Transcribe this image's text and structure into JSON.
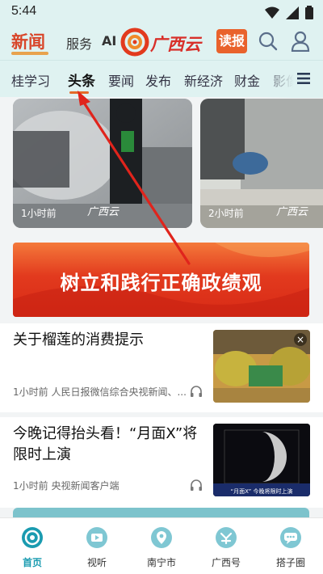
{
  "status": {
    "time": "5:44"
  },
  "header": {
    "news": "新闻",
    "service": "服务",
    "ai": "AI",
    "logo_text": "广西云",
    "read_button": "读报"
  },
  "tabs": [
    {
      "label": "桂学习"
    },
    {
      "label": "头条",
      "active": true
    },
    {
      "label": "要闻"
    },
    {
      "label": "发布"
    },
    {
      "label": "新经济"
    },
    {
      "label": "财金"
    },
    {
      "label": "影像"
    }
  ],
  "image_cards": [
    {
      "time": "1小时前",
      "logo": "广西云"
    },
    {
      "time": "2小时前",
      "logo": "广西云"
    }
  ],
  "banner": {
    "text": "树立和践行正确政绩观"
  },
  "news": [
    {
      "title": "关于榴莲的消费提示",
      "meta": "1小时前   人民日报微信综合央视新闻、...",
      "thumb_icon": "durian-photo"
    },
    {
      "title": "今晚记得抬头看！“月面X”将限时上演",
      "meta": "1小时前   央视新闻客户端",
      "thumb_caption": "“月面X” 今晚将限时上演",
      "thumb_icon": "moon-photo"
    }
  ],
  "bottom_nav": [
    {
      "label": "首页",
      "active": true
    },
    {
      "label": "视听"
    },
    {
      "label": "南宁市"
    },
    {
      "label": "广西号"
    },
    {
      "label": "搭子圈"
    }
  ],
  "colors": {
    "accent": "#e9622c",
    "header_bg": "#dff2f1",
    "nav_active": "#1a9bb0",
    "banner_red": "#d82a16"
  }
}
